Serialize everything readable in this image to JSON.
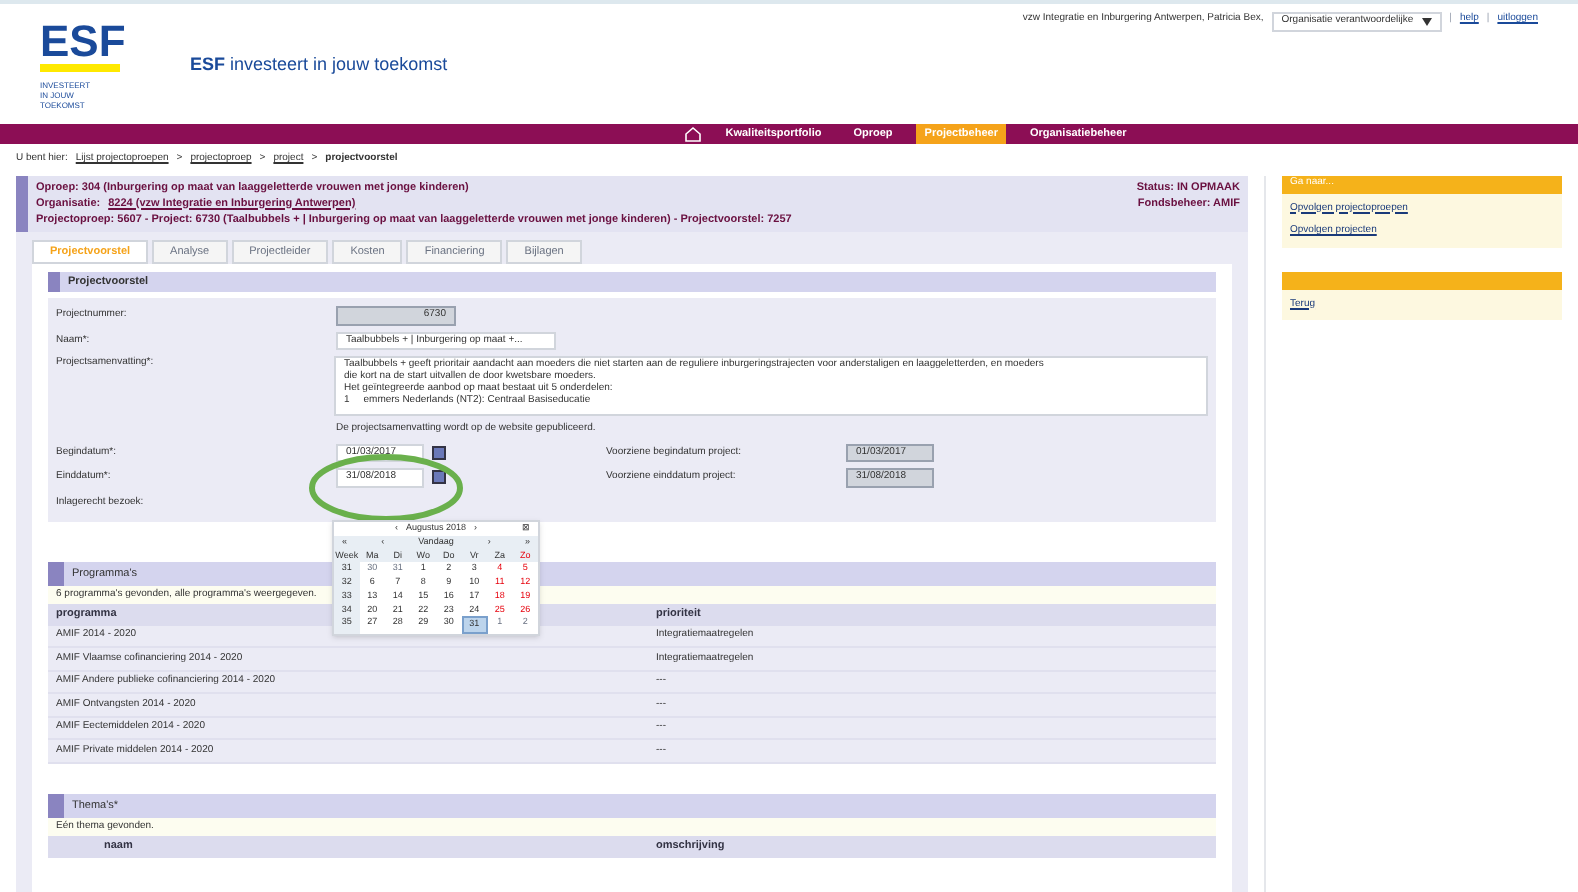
{
  "header": {
    "logo": "ESF",
    "logo_sub": "INVESTEERT IN JOUW TOEKOMST",
    "tagline_bold": "ESF",
    "tagline": "investeert in jouw toekomst",
    "user": "vzw Integratie en Inburgering Antwerpen, Patricia Bex,",
    "role": "Organisatie verantwoordelijke",
    "links": [
      "help",
      "uitloggen"
    ],
    "separator": "|"
  },
  "nav": [
    {
      "label": "Kwaliteitsportfolio",
      "selected": false
    },
    {
      "label": "Oproep",
      "selected": false
    },
    {
      "label": "Projectbeheer",
      "selected": true
    },
    {
      "label": "Organisatiebeheer",
      "selected": false
    }
  ],
  "breadcrumb": {
    "prefix": "U bent hier:",
    "links": [
      "Lijst projectoproepen",
      "projectoproep",
      "project"
    ],
    "current": "projectvoorstel",
    "separator": ">"
  },
  "info": {
    "line1": "Oproep: 304 (Inburgering op maat van laaggeletterde vrouwen met jonge kinderen)",
    "org_label": "Organisatie:",
    "org_link": "8224 (vzw Integratie en Inburgering Antwerpen)",
    "line3": "Projectoproep: 5607 - Project: 6730 (Taalbubbels + | Inburgering op maat van laaggeletterde vrouwen met jonge kinderen) - Projectvoorstel: 7257",
    "status": "Status: IN OPMAAK",
    "fund": "Fondsbeheer: AMIF"
  },
  "tabs": [
    {
      "label": "Projectvoorstel",
      "selected": true
    },
    {
      "label": "Analyse",
      "selected": false
    },
    {
      "label": "Projectleider",
      "selected": false
    },
    {
      "label": "Kosten",
      "selected": false
    },
    {
      "label": "Financiering",
      "selected": false
    },
    {
      "label": "Bijlagen",
      "selected": false
    }
  ],
  "form": {
    "title": "Projectvoorstel",
    "number_label": "Projectnummer:",
    "number": "6730",
    "name_label": "Naam*:",
    "name": "Taalbubbels + | Inburgering op maat +...",
    "summary_label": "Projectsamenvatting*:",
    "summary": [
      "Taalbubbels + geeft prioritair aandacht aan moeders die niet starten aan de reguliere inburgeringstrajecten voor anderstaligen en laaggeletterden, en moeders",
      "die kort na de start uitvallen de door kwetsbare moeders.",
      "Het geïntegreerde aanbod op maat bestaat uit 5 onderdelen:",
      "1     emmers Nederlands (NT2): Centraal Basiseducatie"
    ],
    "summary_note": "De projectsamenvatting wordt op de website gepubliceerd.",
    "start_label": "Begindatum*:",
    "start": "01/03/2017",
    "end_label": "Einddatum*:",
    "end": "31/08/2018",
    "visit_label": "Inlagerecht bezoek:",
    "planned_start_label": "Voorziene begindatum project:",
    "planned_start": "01/03/2017",
    "planned_end_label": "Voorziene einddatum project:",
    "planned_end": "31/08/2018"
  },
  "calendar": {
    "title": "Augustus 2018",
    "prev_title": "‹",
    "next_title": "›",
    "close": "⊠",
    "nav": [
      "«",
      "‹",
      "Vandaag",
      "›",
      "»"
    ],
    "headers": [
      "Week",
      "Ma",
      "Di",
      "Wo",
      "Do",
      "Vr",
      "Za",
      "Zo"
    ],
    "weeks": [
      {
        "week": "31",
        "days": [
          {
            "d": "30",
            "other": true,
            "selected": false
          },
          {
            "d": "31",
            "other": true,
            "selected": false
          },
          {
            "d": "1",
            "other": false,
            "selected": false
          },
          {
            "d": "2",
            "other": false,
            "selected": false
          },
          {
            "d": "3",
            "other": false,
            "selected": false
          },
          {
            "d": "4",
            "other": false,
            "selected": false
          },
          {
            "d": "5",
            "other": false,
            "selected": false
          }
        ]
      },
      {
        "week": "32",
        "days": [
          {
            "d": "6",
            "other": false,
            "selected": false
          },
          {
            "d": "7",
            "other": false,
            "selected": false
          },
          {
            "d": "8",
            "other": false,
            "selected": false
          },
          {
            "d": "9",
            "other": false,
            "selected": false
          },
          {
            "d": "10",
            "other": false,
            "selected": false
          },
          {
            "d": "11",
            "other": false,
            "selected": false
          },
          {
            "d": "12",
            "other": false,
            "selected": false
          }
        ]
      },
      {
        "week": "33",
        "days": [
          {
            "d": "13",
            "other": false,
            "selected": false
          },
          {
            "d": "14",
            "other": false,
            "selected": false
          },
          {
            "d": "15",
            "other": false,
            "selected": false
          },
          {
            "d": "16",
            "other": false,
            "selected": false
          },
          {
            "d": "17",
            "other": false,
            "selected": false
          },
          {
            "d": "18",
            "other": false,
            "selected": false
          },
          {
            "d": "19",
            "other": false,
            "selected": false
          }
        ]
      },
      {
        "week": "34",
        "days": [
          {
            "d": "20",
            "other": false,
            "selected": false
          },
          {
            "d": "21",
            "other": false,
            "selected": false
          },
          {
            "d": "22",
            "other": false,
            "selected": false
          },
          {
            "d": "23",
            "other": false,
            "selected": false
          },
          {
            "d": "24",
            "other": false,
            "selected": false
          },
          {
            "d": "25",
            "other": false,
            "selected": false
          },
          {
            "d": "26",
            "other": false,
            "selected": false
          }
        ]
      },
      {
        "week": "35",
        "days": [
          {
            "d": "27",
            "other": false,
            "selected": false
          },
          {
            "d": "28",
            "other": false,
            "selected": false
          },
          {
            "d": "29",
            "other": false,
            "selected": false
          },
          {
            "d": "30",
            "other": false,
            "selected": false
          },
          {
            "d": "31",
            "other": false,
            "selected": true
          },
          {
            "d": "1",
            "other": true,
            "selected": false
          },
          {
            "d": "2",
            "other": true,
            "selected": false
          }
        ]
      }
    ]
  },
  "programmes": {
    "title": "Programma's",
    "note": "6 programma's gevonden, alle programma's weergegeven.",
    "columns": [
      "programma",
      "prioriteit"
    ],
    "rows": [
      [
        "AMIF 2014 - 2020",
        "Integratiemaatregelen"
      ],
      [
        "AMIF Vlaamse cofinanciering 2014 - 2020",
        "Integratiemaatregelen"
      ],
      [
        "AMIF Andere publieke cofinanciering 2014 - 2020",
        "---"
      ],
      [
        "AMIF Ontvangsten 2014 - 2020",
        "---"
      ],
      [
        "AMIF Eectemiddelen 2014 - 2020",
        "---"
      ],
      [
        "AMIF Private middelen 2014 - 2020",
        "---"
      ]
    ]
  },
  "themes": {
    "title": "Thema's*",
    "note": "Eén thema gevonden.",
    "columns": [
      "naam",
      "omschrijving"
    ]
  },
  "sidebar": [
    {
      "title": "Ga naar...",
      "links": [
        "Opvolgen projectoproepen",
        "Opvolgen projecten"
      ]
    },
    {
      "links": [
        "Terug"
      ]
    }
  ]
}
